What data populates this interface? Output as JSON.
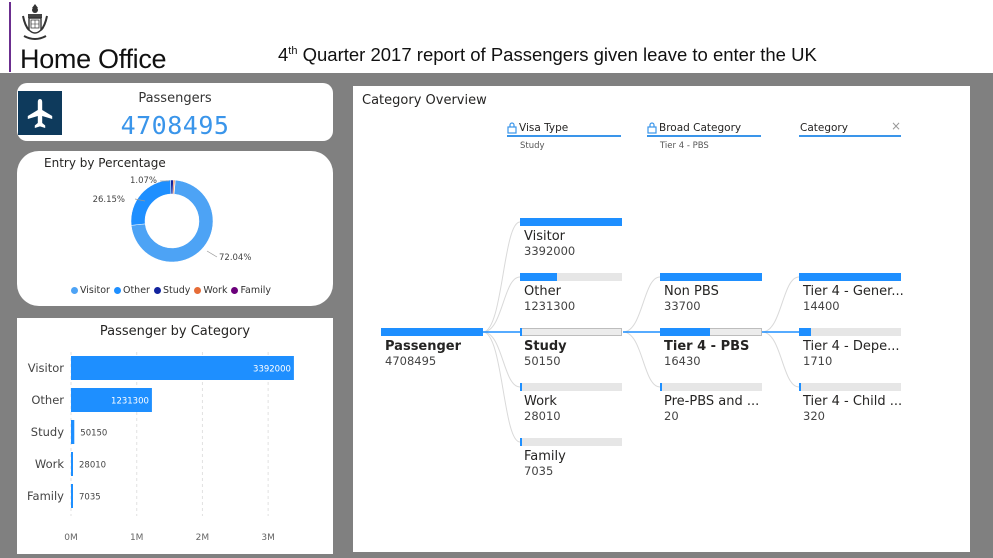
{
  "header": {
    "org_name": "Home Office",
    "title_prefix": "4",
    "title_sup": "th",
    "title_rest": " Quarter 2017 report of Passengers given leave to enter the UK"
  },
  "kpi": {
    "label": "Passengers",
    "value": "4708495",
    "icon": "airplane-icon"
  },
  "donut": {
    "title": "Entry by Percentage",
    "labels": {
      "other": "26.15%",
      "study": "1.07%",
      "visitor": "72.04%"
    },
    "legend": [
      {
        "name": "Visitor",
        "color": "#4da3f5"
      },
      {
        "name": "Other",
        "color": "#1e8fff"
      },
      {
        "name": "Study",
        "color": "#12239e"
      },
      {
        "name": "Work",
        "color": "#e66c37"
      },
      {
        "name": "Family",
        "color": "#6b007b"
      }
    ]
  },
  "bar_chart": {
    "title": "Passenger by Category"
  },
  "tree": {
    "title": "Category Overview",
    "filters": [
      {
        "label": "Visa Type",
        "sub": "Study",
        "icon": "lock-icon"
      },
      {
        "label": "Broad Category",
        "sub": "Tier 4 - PBS",
        "icon": "lock-icon"
      },
      {
        "label": "Category",
        "sub": "",
        "icon": "close-icon"
      }
    ],
    "root": {
      "label": "Passenger",
      "value": "4708495",
      "fill": 1.0
    },
    "level1": [
      {
        "label": "Visitor",
        "value": "3392000",
        "fill": 1.0
      },
      {
        "label": "Other",
        "value": "1231300",
        "fill": 0.363
      },
      {
        "label": "Study",
        "value": "50150",
        "fill": 0.015
      },
      {
        "label": "Work",
        "value": "28010",
        "fill": 0.008
      },
      {
        "label": "Family",
        "value": "7035",
        "fill": 0.002
      }
    ],
    "level2": [
      {
        "label": "Non PBS",
        "value": "33700",
        "fill": 1.0
      },
      {
        "label": "Tier 4 - PBS",
        "value": "16430",
        "fill": 0.488
      },
      {
        "label": "Pre-PBS and ...",
        "value": "20",
        "fill": 0.001
      }
    ],
    "level3": [
      {
        "label": "Tier 4 - Gener...",
        "value": "14400",
        "fill": 1.0
      },
      {
        "label": "Tier 4 - Depe...",
        "value": "1710",
        "fill": 0.119
      },
      {
        "label": "Tier 4 - Child ...",
        "value": "320",
        "fill": 0.022
      }
    ]
  },
  "chart_data": [
    {
      "type": "pie",
      "title": "Entry by Percentage",
      "categories": [
        "Visitor",
        "Other",
        "Study",
        "Work",
        "Family"
      ],
      "values": [
        72.04,
        26.15,
        1.07,
        0.59,
        0.15
      ],
      "colors": [
        "#4da3f5",
        "#1e8fff",
        "#12239e",
        "#e66c37",
        "#6b007b"
      ],
      "donut": true,
      "legend": "bottom"
    },
    {
      "type": "bar",
      "orientation": "horizontal",
      "title": "Passenger by Category",
      "categories": [
        "Visitor",
        "Other",
        "Study",
        "Work",
        "Family"
      ],
      "values": [
        3392000,
        1231300,
        50150,
        28010,
        7035
      ],
      "xlim": [
        0,
        3500000
      ],
      "xticks": [
        "0M",
        "1M",
        "2M",
        "3M"
      ],
      "xtick_values": [
        0,
        1000000,
        2000000,
        3000000
      ],
      "color": "#1e8fff",
      "grid": true
    }
  ]
}
